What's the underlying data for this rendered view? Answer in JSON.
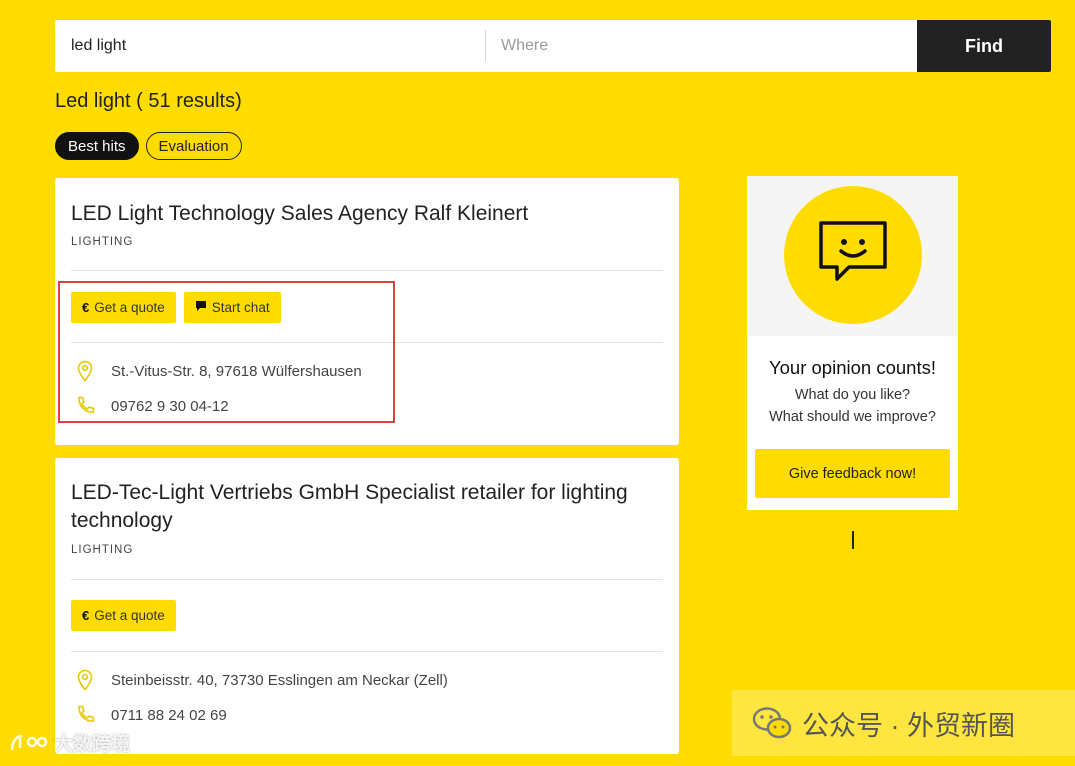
{
  "search": {
    "what_value": "led light",
    "where_placeholder": "Where",
    "find_label": "Find"
  },
  "results_title": "Led light ( 51 results)",
  "tabs": [
    {
      "label": "Best hits",
      "active": true
    },
    {
      "label": "Evaluation",
      "active": false
    }
  ],
  "listings": [
    {
      "title": "LED Light Technology Sales Agency Ralf Kleinert",
      "category": "LIGHTING",
      "quote_label": "Get a quote",
      "chat_label": "Start chat",
      "address": "St.-Vitus-Str. 8, 97618 Wülfershausen",
      "phone": "09762 9 30 04-12"
    },
    {
      "title": "LED-Tec-Light Vertriebs GmbH Specialist retailer for lighting technology",
      "category": "LIGHTING",
      "quote_label": "Get a quote",
      "address": "Steinbeisstr. 40, 73730 Esslingen am Neckar  (Zell)",
      "phone": "0711 88 24 02 69"
    }
  ],
  "icons": {
    "euro": "€",
    "location": "location-pin-icon",
    "phone": "phone-icon",
    "chat": "chat-bubble-icon"
  },
  "feedback": {
    "title": "Your opinion counts!",
    "line1": "What do you like?",
    "line2": "What should we improve?",
    "button": "Give feedback now!"
  },
  "watermarks": {
    "left": "大数跨境",
    "right": "公众号 · 外贸新圈"
  },
  "colors": {
    "background": "#FFDC00",
    "dark": "#222222",
    "highlight_box": "#D9423F"
  }
}
